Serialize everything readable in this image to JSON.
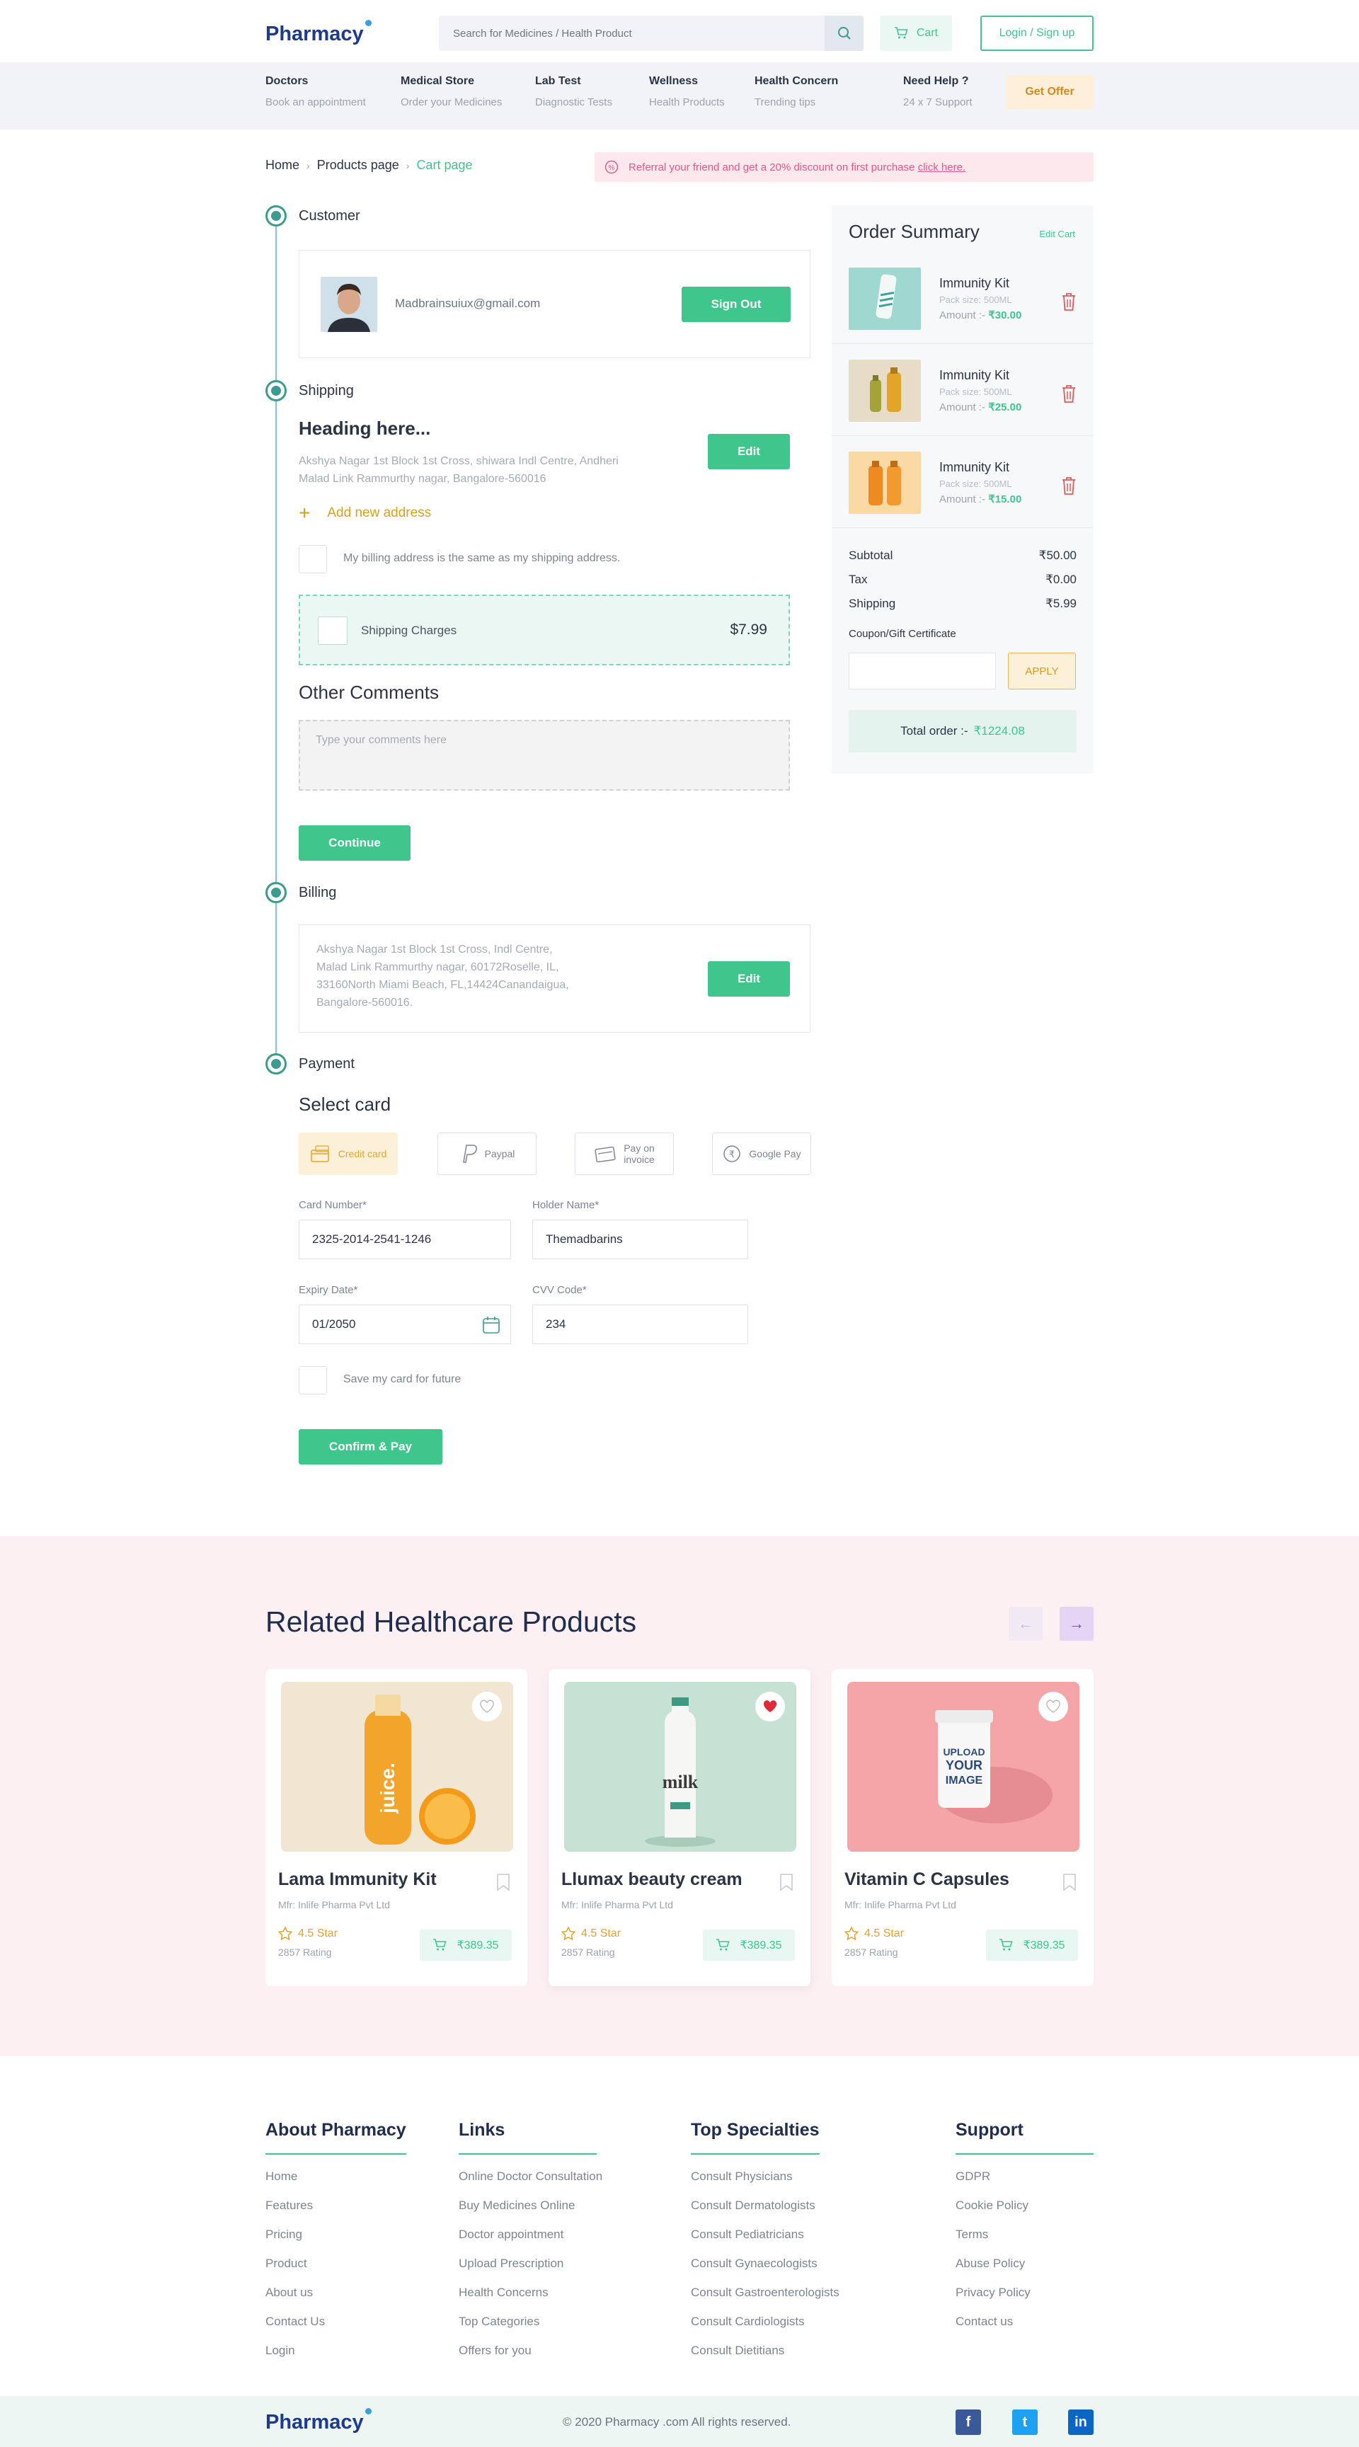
{
  "header": {
    "logo": "Pharmacy",
    "search_placeholder": "Search for Medicines / Health Product",
    "cart_label": "Cart",
    "login_label": "Login / Sign up"
  },
  "nav": {
    "items": [
      {
        "title": "Doctors",
        "sub": "Book an appointment"
      },
      {
        "title": "Medical Store",
        "sub": "Order your Medicines"
      },
      {
        "title": "Lab Test",
        "sub": "Diagnostic Tests"
      },
      {
        "title": "Wellness",
        "sub": "Health Products"
      },
      {
        "title": "Health Concern",
        "sub": "Trending tips"
      },
      {
        "title": "Need Help ?",
        "sub": "24 x 7 Support"
      }
    ],
    "offer_label": "Get Offer"
  },
  "breadcrumb": {
    "home": "Home",
    "products": "Products page",
    "current": "Cart page"
  },
  "referral": {
    "text": "Referral your friend and get a 20% discount on first purchase",
    "link": "click here."
  },
  "checkout": {
    "customer": {
      "label": "Customer",
      "email": "Madbrainsuiux@gmail.com",
      "signout": "Sign Out"
    },
    "shipping": {
      "label": "Shipping",
      "heading": "Heading here...",
      "address_line1": "Akshya Nagar 1st Block 1st Cross, shiwara Indl Centre, Andheri",
      "address_line2": "Malad Link Rammurthy nagar, Bangalore-560016",
      "edit": "Edit",
      "add_address": "Add new address",
      "billing_same": "My billing address is the same as my shipping address.",
      "charges_label": "Shipping Charges",
      "charges_value": "$7.99",
      "comments_title": "Other Comments",
      "comments_placeholder": "Type your comments here",
      "continue": "Continue"
    },
    "billing": {
      "label": "Billing",
      "line1": "Akshya Nagar 1st Block 1st Cross, Indl Centre,",
      "line2": "Malad Link Rammurthy nagar, 60172Roselle, IL,",
      "line3": "33160North Miami Beach, FL,14424Canandaigua,",
      "line4": "Bangalore-560016.",
      "edit": "Edit"
    },
    "payment": {
      "label": "Payment",
      "select_card": "Select card",
      "options": {
        "credit": "Credit card",
        "paypal": "Paypal",
        "invoice_1": "Pay on",
        "invoice_2": "invoice",
        "google": "Google Pay"
      },
      "card_number_label": "Card Number*",
      "card_number": "2325-2014-2541-1246",
      "holder_label": "Holder Name*",
      "holder": "Themadbarins",
      "expiry_label": "Expiry Date*",
      "expiry": "01/2050",
      "cvv_label": "CVV Code*",
      "cvv": "234",
      "save_card": "Save my card for future",
      "confirm": "Confirm & Pay"
    }
  },
  "summary": {
    "title": "Order Summary",
    "edit_cart": "Edit Cart",
    "items": [
      {
        "name": "Immunity Kit",
        "pack": "Pack size: 500ML",
        "amount_label": "Amount :-",
        "amount": "₹30.00"
      },
      {
        "name": "Immunity Kit",
        "pack": "Pack size: 500ML",
        "amount_label": "Amount :-",
        "amount": "₹25.00"
      },
      {
        "name": "Immunity Kit",
        "pack": "Pack size: 500ML",
        "amount_label": "Amount :-",
        "amount": "₹15.00"
      }
    ],
    "subtotal_label": "Subtotal",
    "subtotal": "₹50.00",
    "tax_label": "Tax",
    "tax": "₹0.00",
    "shipping_label": "Shipping",
    "shipping": "₹5.99",
    "coupon_label": "Coupon/Gift Certificate",
    "apply": "APPLY",
    "total_label": "Total order :-",
    "total": "₹1224.08"
  },
  "related": {
    "title": "Related Healthcare Products",
    "products": [
      {
        "name": "Lama Immunity Kit",
        "mfr": "Mfr: Inlife Pharma Pvt Ltd",
        "rating": "4.5 Star",
        "count": "2857 Rating",
        "price": "₹389.35",
        "img_text": "juice."
      },
      {
        "name": "Llumax beauty cream",
        "mfr": "Mfr: Inlife Pharma Pvt Ltd",
        "rating": "4.5 Star",
        "count": "2857 Rating",
        "price": "₹389.35",
        "img_text": "milk"
      },
      {
        "name": "Vitamin C Capsules",
        "mfr": "Mfr: Inlife Pharma Pvt Ltd",
        "rating": "4.5 Star",
        "count": "2857 Rating",
        "price": "₹389.35",
        "img_text_1": "UPLOAD",
        "img_text_2": "YOUR",
        "img_text_3": "IMAGE"
      }
    ]
  },
  "footer": {
    "about": {
      "title": "About Pharmacy",
      "links": [
        "Home",
        "Features",
        "Pricing",
        "Product",
        "About us",
        "Contact Us",
        "Login"
      ]
    },
    "links": {
      "title": "Links",
      "links": [
        "Online Doctor Consultation",
        "Buy Medicines Online",
        "Doctor appointment",
        "Upload Prescription",
        "Health Concerns",
        "Top Categories",
        "Offers for you"
      ]
    },
    "specialties": {
      "title": "Top Specialties",
      "links": [
        "Consult Physicians",
        "Consult Dermatologists",
        "Consult Pediatricians",
        "Consult Gynaecologists",
        "Consult Gastroenterologists",
        "Consult Cardiologists",
        "Consult Dietitians"
      ]
    },
    "support": {
      "title": "Support",
      "links": [
        "GDPR",
        "Cookie Policy",
        "Terms",
        "Abuse Policy",
        "Privacy Policy",
        "Contact us"
      ]
    },
    "logo": "Pharmacy",
    "copyright": "© 2020 Pharmacy .com All rights reserved.",
    "social": {
      "facebook": "f",
      "twitter": "t",
      "linkedin": "in"
    }
  },
  "colors": {
    "accent": "#3fc68d",
    "brand": "#1e3a8a",
    "timeline": "#3a9b8e",
    "pink_bg": "#fdf0f3"
  }
}
